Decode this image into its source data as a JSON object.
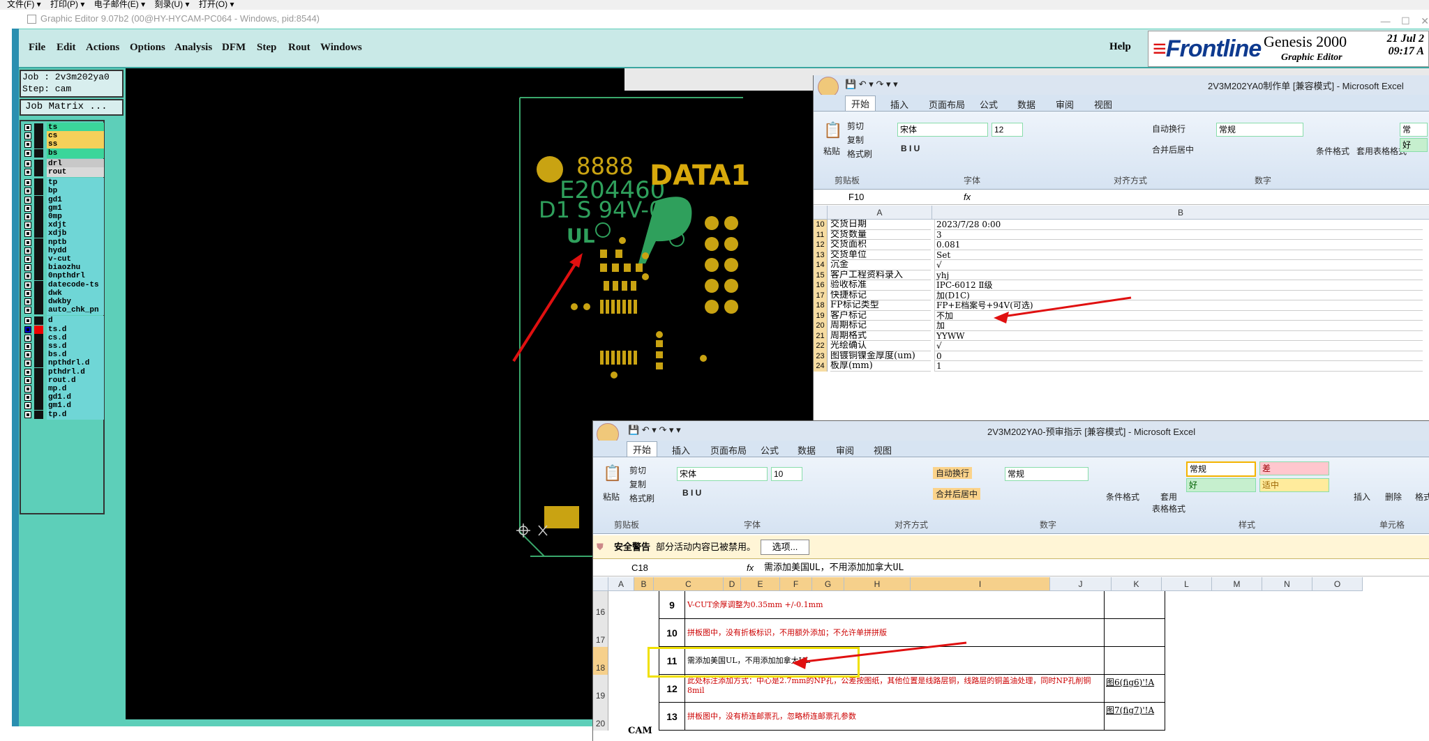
{
  "os_menu": [
    "文件(F)",
    "打印(P)",
    "电子邮件(E)",
    "刻录(U)",
    "打开(O)"
  ],
  "app": {
    "title": "Graphic Editor 9.07b2 (00@HY-HYCAM-PC064 - Windows, pid:8544)"
  },
  "ge": {
    "menu": [
      "File",
      "Edit",
      "Actions",
      "Options",
      "Analysis",
      "DFM",
      "Step",
      "Rout",
      "Windows"
    ],
    "help": "Help",
    "logo": {
      "brand": "Frontline",
      "product": "Genesis 2000",
      "subtitle": "Graphic Editor",
      "date": "21 Jul 2",
      "time": "09:17 A"
    },
    "job_label": "Job : 2v3m202ya0",
    "step_label": "Step: cam",
    "matrix_button": "Job Matrix ...",
    "layers": [
      {
        "name": "ts",
        "color": "#3bd69a"
      },
      {
        "name": "cs",
        "color": "#f5d05a"
      },
      {
        "name": "ss",
        "color": "#f5d05a"
      },
      {
        "name": "bs",
        "color": "#3bd69a"
      },
      {
        "name": "drl",
        "color": "#c8c8c8"
      },
      {
        "name": "rout",
        "color": "#d9d9d9"
      },
      {
        "name": "tp",
        "color": "#6fd6d6"
      },
      {
        "name": "bp",
        "color": "#6fd6d6"
      },
      {
        "name": "gd1",
        "color": "#6fd6d6"
      },
      {
        "name": "gm1",
        "color": "#6fd6d6"
      },
      {
        "name": "0mp",
        "color": "#6fd6d6"
      },
      {
        "name": "xdjt",
        "color": "#6fd6d6"
      },
      {
        "name": "xdjb",
        "color": "#6fd6d6"
      },
      {
        "name": "nptb",
        "color": "#6fd6d6"
      },
      {
        "name": "hydd",
        "color": "#6fd6d6"
      },
      {
        "name": "v-cut",
        "color": "#6fd6d6"
      },
      {
        "name": "biaozhu",
        "color": "#6fd6d6"
      },
      {
        "name": "0npthdrl",
        "color": "#6fd6d6"
      },
      {
        "name": "datecode-ts",
        "color": "#6fd6d6"
      },
      {
        "name": "dwk",
        "color": "#6fd6d6"
      },
      {
        "name": "dwkby",
        "color": "#6fd6d6"
      },
      {
        "name": "auto_chk_pn",
        "color": "#6fd6d6"
      },
      {
        "name": "d",
        "color": "#6fd6d6"
      },
      {
        "name": "ts.d",
        "color": "#6fd6d6"
      },
      {
        "name": "cs.d",
        "color": "#6fd6d6"
      },
      {
        "name": "ss.d",
        "color": "#6fd6d6"
      },
      {
        "name": "bs.d",
        "color": "#6fd6d6"
      },
      {
        "name": "npthdrl.d",
        "color": "#6fd6d6"
      },
      {
        "name": "pthdrl.d",
        "color": "#6fd6d6"
      },
      {
        "name": "rout.d",
        "color": "#6fd6d6"
      },
      {
        "name": "mp.d",
        "color": "#6fd6d6"
      },
      {
        "name": "gd1.d",
        "color": "#6fd6d6"
      },
      {
        "name": "gm1.d",
        "color": "#6fd6d6"
      },
      {
        "name": "tp.d",
        "color": "#6fd6d6"
      }
    ],
    "pcb_text": {
      "digits": "8888",
      "ul_no": "E204460",
      "grade": "D1 S 94V-0",
      "data": "DATA1"
    }
  },
  "excel_a": {
    "title": "2V3M202YA0制作单 [兼容模式] - Microsoft Excel",
    "tabs": [
      "开始",
      "插入",
      "页面布局",
      "公式",
      "数据",
      "审阅",
      "视图"
    ],
    "clipboard": {
      "paste": "粘贴",
      "cut": "剪切",
      "copy": "复制",
      "format": "格式刷",
      "group": "剪贴板"
    },
    "font": {
      "name": "宋体",
      "size": "12",
      "group": "字体"
    },
    "align_group": "对齐方式",
    "wrap": "自动换行",
    "merge": "合并后居中",
    "number": {
      "format": "常规",
      "group": "数字"
    },
    "cond": "条件格式",
    "table": "套用表格格式",
    "style_changgui": "常",
    "style_hao": "好",
    "namebox": "F10",
    "fx": "fx",
    "col_a": "A",
    "col_b": "B",
    "rows": [
      {
        "n": "10",
        "a": "交货日期",
        "b": "2023/7/28 0:00"
      },
      {
        "n": "11",
        "a": "交货数量",
        "b": "3"
      },
      {
        "n": "12",
        "a": "交货面积",
        "b": "0.081"
      },
      {
        "n": "13",
        "a": "交货单位",
        "b": "Set"
      },
      {
        "n": "14",
        "a": "沉金",
        "b": "√"
      },
      {
        "n": "15",
        "a": "客户工程资料录入",
        "b": "yhj"
      },
      {
        "n": "16",
        "a": "验收标准",
        "b": "IPC-6012 Ⅱ级"
      },
      {
        "n": "17",
        "a": "快捷标记",
        "b": "加(D1C)"
      },
      {
        "n": "18",
        "a": "FP标记类型",
        "b": "FP+E档案号+94V(可选)"
      },
      {
        "n": "19",
        "a": "客户标记",
        "b": "不加"
      },
      {
        "n": "20",
        "a": "周期标记",
        "b": "加"
      },
      {
        "n": "21",
        "a": "周期格式",
        "b": "YYWW"
      },
      {
        "n": "22",
        "a": "光绘确认",
        "b": "√"
      },
      {
        "n": "23",
        "a": "图镀铜镍金厚度(um)",
        "b": "0"
      },
      {
        "n": "24",
        "a": "板厚(mm)",
        "b": "1"
      }
    ]
  },
  "excel_b": {
    "title": "2V3M202YA0-预审指示 [兼容模式] - Microsoft Excel",
    "tabs": [
      "开始",
      "插入",
      "页面布局",
      "公式",
      "数据",
      "审阅",
      "视图"
    ],
    "clipboard": {
      "paste": "粘贴",
      "cut": "剪切",
      "copy": "复制",
      "format": "格式刷",
      "group": "剪贴板"
    },
    "font": {
      "name": "宋体",
      "size": "10",
      "group": "字体"
    },
    "align_group": "对齐方式",
    "wrap": "自动换行",
    "merge": "合并后居中",
    "number": {
      "format": "常规",
      "group": "数字"
    },
    "cond": "条件格式",
    "table": "套用\n表格格式",
    "styles": {
      "normal": "常规",
      "bad": "差",
      "good": "好",
      "neutral": "适中",
      "group": "样式"
    },
    "cells": {
      "insert": "插入",
      "delete": "删除",
      "format": "格式",
      "group": "单元格"
    },
    "security": {
      "label": "安全警告",
      "msg": "部分活动内容已被禁用。",
      "button": "选项..."
    },
    "namebox": "C18",
    "fx": "fx",
    "formula": "需添加美国UL，不用添加加拿大UL",
    "cols": [
      "A",
      "B",
      "C",
      "D",
      "E",
      "F",
      "G",
      "H",
      "I",
      "J",
      "K",
      "L",
      "M",
      "N",
      "O"
    ],
    "rows": [
      {
        "n": "16",
        "no": "9",
        "text": "V-CUT余厚调整为0.35mm +/-0.1mm",
        "j": ""
      },
      {
        "n": "17",
        "no": "10",
        "text": "拼板图中，没有折板标识，不用额外添加；不允许单拼拼版",
        "j": ""
      },
      {
        "n": "18",
        "no": "11",
        "text": "需添加美国UL，不用添加加拿大UL",
        "j": ""
      },
      {
        "n": "19",
        "no": "12",
        "text": "此处标注添加方式：中心是2.7mm的NP孔，公差按图纸，其他位置是线路层铜，线路层的铜盖油处理，同时NP孔削铜8mil",
        "j": "图6(fig6)'!A"
      },
      {
        "n": "20",
        "no": "13",
        "text": "拼板图中，没有桥连邮票孔，忽略桥连邮票孔参数",
        "j": "图7(fig7)'!A"
      }
    ],
    "cam_label": "CAM"
  }
}
